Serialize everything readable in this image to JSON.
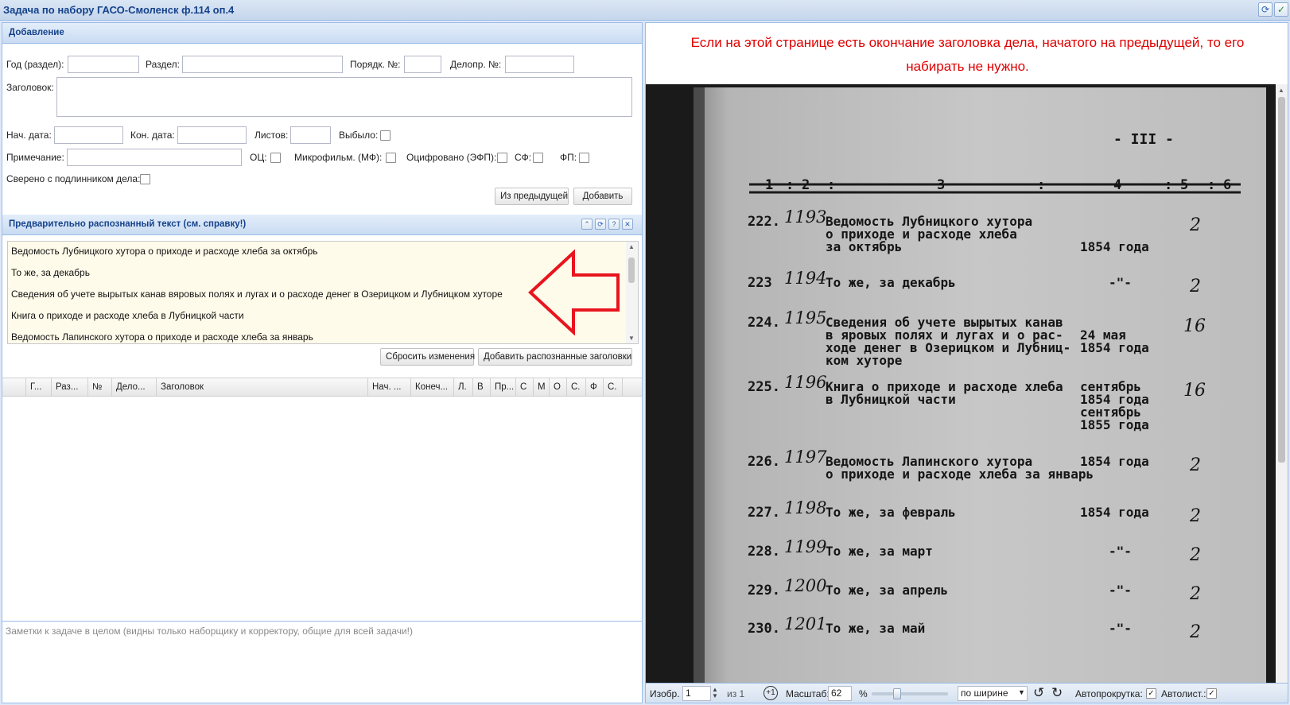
{
  "window": {
    "title": "Задача по набору ГАСО-Смоленск ф.114 оп.4"
  },
  "add_panel": {
    "title": "Добавление",
    "labels": {
      "year": "Год (раздел):",
      "section": "Раздел:",
      "order_no": "Порядк. №:",
      "delopr_no": "Делопр. №:",
      "heading": "Заголовок:",
      "start_date": "Нач. дата:",
      "end_date": "Кон. дата:",
      "sheets": "Листов:",
      "removed": "Выбыло:",
      "note": "Примечание:",
      "oc": "ОЦ:",
      "microfilm": "Микрофильм. (МФ):",
      "digitized": "Оцифровано (ЭФП):",
      "sf": "СФ:",
      "fp": "ФП:",
      "verified": "Сверено с подлинником дела:"
    },
    "buttons": {
      "from_previous": "Из предыдущей",
      "add": "Добавить"
    }
  },
  "recognized_panel": {
    "title": "Предварительно распознанный текст (см. справку!)",
    "items": [
      "Ведомость Лубницкого хутора о приходе и расходе хлеба за октябрь",
      "То же, за декабрь",
      "Сведения об учете вырытых канав вяровых полях и лугах и о расходе денег в Озерицком и Лубницком хуторе",
      "Книга о приходе и расходе хлеба в Лубницкой части",
      "Ведомость Лапинского хутора о приходе и расходе хлеба за январь"
    ],
    "buttons": {
      "reset": "Сбросить изменения",
      "add_recognized": "Добавить распознанные заголовки"
    }
  },
  "grid": {
    "columns": [
      "Г...",
      "Раз...",
      "№",
      "Дело...",
      "Заголовок",
      "Нач. ...",
      "Конеч...",
      "Л.",
      "В",
      "Пр...",
      "С",
      "М",
      "О",
      "С.",
      "Ф",
      "С."
    ]
  },
  "notes": {
    "placeholder": "Заметки к задаче в целом (видны только наборщику и корректору, общие для всей задачи!)"
  },
  "right_panel": {
    "warning_line1": "Если на этой странице есть окончание заголовка дела, начатого на предыдущей, то его",
    "warning_line2": "набирать не нужно."
  },
  "document": {
    "page_number": "- III -",
    "header_cells": [
      "1",
      ":",
      "2",
      ":",
      "3",
      ":",
      "4",
      ":",
      "5",
      ":",
      "6"
    ],
    "rows": [
      {
        "num": "222.",
        "hand": "1193",
        "text": [
          "Ведомость Лубницкого хутора",
          "о приходе и расходе хлеба",
          "за октябрь"
        ],
        "date": [
          "",
          "",
          "1854 года"
        ],
        "sheets": "2"
      },
      {
        "num": "223",
        "hand": "1194",
        "text": [
          "То же, за декабрь"
        ],
        "date": [
          "-\"-"
        ],
        "sheets": "2"
      },
      {
        "num": "224.",
        "hand": "1195",
        "text": [
          "Сведения об учете вырытых канав",
          "в яровых полях и лугах и о рас-",
          "ходе денег в Озерицком и Лубниц-",
          "ком хуторе"
        ],
        "date": [
          "",
          "24 мая",
          "1854 года",
          ""
        ],
        "sheets": "16"
      },
      {
        "num": "225.",
        "hand": "1196",
        "text": [
          "Книга о приходе и расходе хлеба",
          "в Лубницкой части"
        ],
        "date": [
          "сентябрь",
          "1854 года",
          "сентябрь",
          "1855 года"
        ],
        "sheets": "16"
      },
      {
        "num": "226.",
        "hand": "1197",
        "text": [
          "Ведомость Лапинского хутора",
          "о приходе и расходе хлеба за январь"
        ],
        "date": [
          "1854 года",
          ""
        ],
        "sheets": "2"
      },
      {
        "num": "227.",
        "hand": "1198",
        "text": [
          "То же, за февраль"
        ],
        "date": [
          "1854 года"
        ],
        "sheets": "2"
      },
      {
        "num": "228.",
        "hand": "1199",
        "text": [
          "То же, за март"
        ],
        "date": [
          "-\"-"
        ],
        "sheets": "2"
      },
      {
        "num": "229.",
        "hand": "1200",
        "text": [
          "То же, за апрель"
        ],
        "date": [
          "-\"-"
        ],
        "sheets": "2"
      },
      {
        "num": "230.",
        "hand": "1201",
        "text": [
          "То же, за май"
        ],
        "date": [
          "-\"-"
        ],
        "sheets": "2"
      }
    ]
  },
  "statusbar": {
    "image_label": "Изобр.",
    "image_value": "1",
    "of_label": "из 1",
    "scale_label": "Масштаб:",
    "scale_value": "62",
    "percent": "%",
    "fit_value": "по ширине",
    "autoscroll_label": "Автопрокрутка:",
    "autosheet_label": "Автолист.:"
  },
  "colors": {
    "accent": "#15428b",
    "warning": "#e00000",
    "arrow": "#e8141e",
    "recognized_bg": "#fffbea"
  }
}
